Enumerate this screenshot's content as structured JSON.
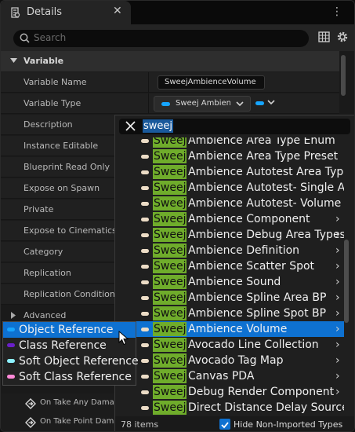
{
  "tab": {
    "title": "Details",
    "close": "✕"
  },
  "window_menu": "⋮",
  "search": {
    "placeholder": "Search"
  },
  "category": {
    "label": "Variable"
  },
  "properties": [
    {
      "name": "Variable Name"
    },
    {
      "name": "Variable Type"
    },
    {
      "name": "Description"
    },
    {
      "name": "Instance Editable"
    },
    {
      "name": "Blueprint Read Only"
    },
    {
      "name": "Expose on Spawn"
    },
    {
      "name": "Private"
    },
    {
      "name": "Expose to Cinematics"
    },
    {
      "name": "Category"
    },
    {
      "name": "Replication"
    },
    {
      "name": "Replication Condition"
    }
  ],
  "variable_name_value": "SweejAmbienceVolume",
  "variable_type_value": "Sweej Ambience Volume",
  "advanced_label": "Advanced",
  "events": [
    {
      "label": "On Take Any Damage"
    },
    {
      "label": "On Take Point Damage"
    }
  ],
  "picker": {
    "query": "sweej",
    "highlight": "Sweej",
    "items": [
      {
        "rest": "Ambience Area Type Enum",
        "submenu": false
      },
      {
        "rest": "Ambience Area Type Preset",
        "submenu": false
      },
      {
        "rest": "Ambience Autotest Area Type",
        "submenu": false
      },
      {
        "rest": "Ambience Autotest- Single Area",
        "submenu": false
      },
      {
        "rest": "Ambience Autotest- Volume Inte",
        "submenu": false
      },
      {
        "rest": "Ambience Component",
        "submenu": true
      },
      {
        "rest": "Ambience Debug Area Types",
        "submenu": true
      },
      {
        "rest": "Ambience Definition",
        "submenu": true
      },
      {
        "rest": "Ambience Scatter Spot",
        "submenu": true
      },
      {
        "rest": "Ambience Sound",
        "submenu": true
      },
      {
        "rest": "Ambience Spline Area BP",
        "submenu": true
      },
      {
        "rest": "Ambience Spline Spot BP",
        "submenu": true
      },
      {
        "rest": "Ambience Volume",
        "submenu": true,
        "selected": true
      },
      {
        "rest": "Avocado Line Collection",
        "submenu": true
      },
      {
        "rest": "Avocado Tag Map",
        "submenu": true
      },
      {
        "rest": "Canvas PDA",
        "submenu": true
      },
      {
        "rest": "Debug Render Component",
        "submenu": true
      },
      {
        "rest": "Direct Distance Delay Source",
        "submenu": false
      }
    ],
    "item_count": "78 items",
    "hide_non_imported_label": "Hide Non-Imported Types",
    "hide_non_imported_checked": true
  },
  "reference_menu": [
    {
      "label": "Object Reference",
      "color": "#16a5ff",
      "selected": true
    },
    {
      "label": "Class Reference",
      "color": "#6a1fc8"
    },
    {
      "label": "Soft Object Reference",
      "color": "#8ef2ff"
    },
    {
      "label": "Soft Class Reference",
      "color": "#ff8ad8"
    }
  ],
  "colors": {
    "accent": "#0e71d1",
    "object_pin": "#16a5ff",
    "struct_pin": "#ecdcc6",
    "search_highlight": "#6fac2b"
  }
}
